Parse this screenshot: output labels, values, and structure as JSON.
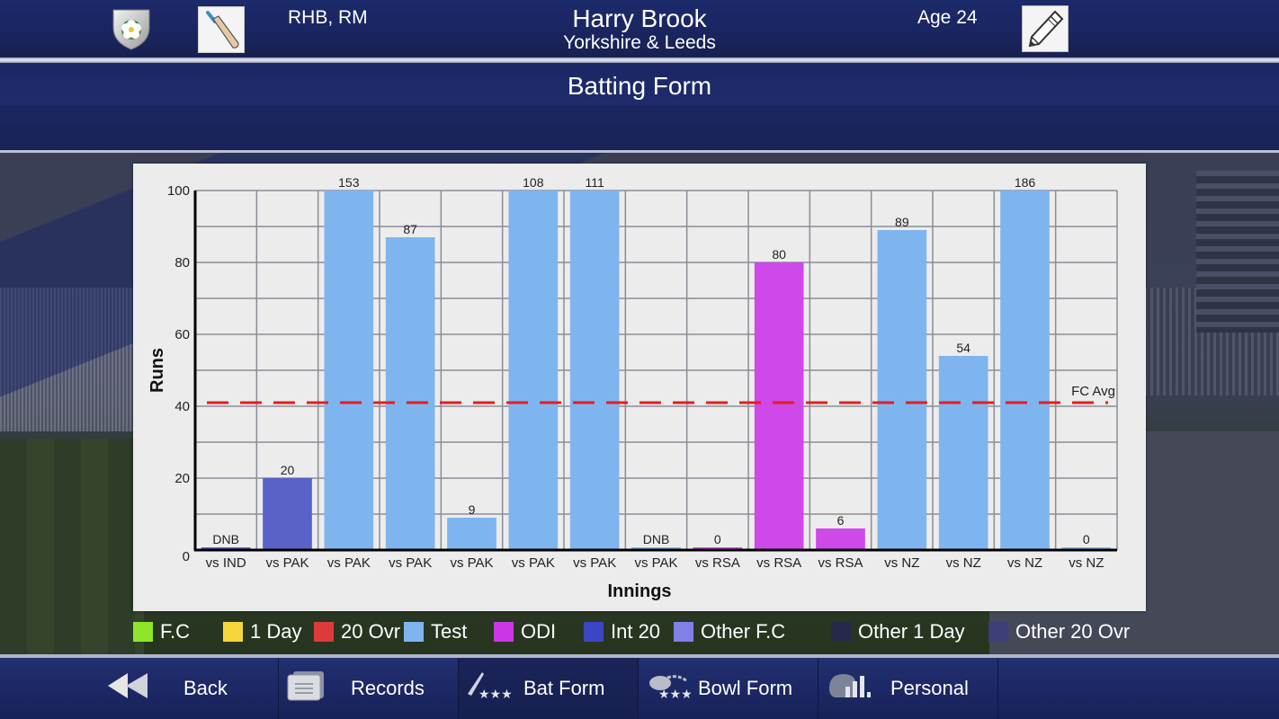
{
  "header": {
    "player_name": "Harry Brook",
    "club": "Yorkshire & Leeds",
    "roles": "RHB, RM",
    "age": "Age 24",
    "crest_icon": "yorkshire-rose-crest-icon",
    "bat_icon": "cricket-bat-icon",
    "edit_icon": "pencil-icon"
  },
  "page": {
    "title": "Batting Form"
  },
  "chart_data": {
    "type": "bar",
    "title": "Batting Form",
    "xlabel": "Innings",
    "ylabel": "Runs",
    "ylim": [
      0,
      100
    ],
    "yticks": [
      0,
      20,
      40,
      60,
      80,
      100
    ],
    "grid": true,
    "reference_line": {
      "label": "FC Avg",
      "value": 41,
      "color": "#e02020",
      "style": "dashed"
    },
    "categories": [
      "vs IND",
      "vs PAK",
      "vs PAK",
      "vs PAK",
      "vs PAK",
      "vs PAK",
      "vs PAK",
      "vs PAK",
      "vs RSA",
      "vs RSA",
      "vs RSA",
      "vs NZ",
      "vs NZ",
      "vs NZ",
      "vs NZ"
    ],
    "values": [
      0,
      20,
      153,
      87,
      9,
      108,
      111,
      0,
      0,
      80,
      6,
      89,
      54,
      186,
      0
    ],
    "labels": [
      "DNB",
      "20",
      "153",
      "87",
      "9",
      "108",
      "111",
      "DNB",
      "0",
      "80",
      "6",
      "89",
      "54",
      "186",
      "0"
    ],
    "formats": [
      "Int 20",
      "Int 20",
      "Test",
      "Test",
      "Test",
      "Test",
      "Test",
      "Test",
      "ODI",
      "ODI",
      "ODI",
      "Test",
      "Test",
      "Test",
      "Test"
    ]
  },
  "legend": [
    {
      "label": "F.C",
      "color": "#8ee62a"
    },
    {
      "label": "1 Day",
      "color": "#f4d63a"
    },
    {
      "label": "20 Ovr",
      "color": "#de3a3a"
    },
    {
      "label": "Test",
      "color": "#7fb5ef"
    },
    {
      "label": "ODI",
      "color": "#cc36e6"
    },
    {
      "label": "Int 20",
      "color": "#3b46c4"
    },
    {
      "label": "Other F.C",
      "color": "#8080e8"
    },
    {
      "label": "Other 1 Day",
      "color": "#262a48"
    },
    {
      "label": "Other 20 Ovr",
      "color": "#3c3f78"
    }
  ],
  "format_colors": {
    "Test": "#7fb5ef",
    "ODI": "#cf48ea",
    "Int 20": "#5a62c8"
  },
  "nav": [
    {
      "label": "Back",
      "icon": "double-chevron-left-icon"
    },
    {
      "label": "Records",
      "icon": "folder-icon"
    },
    {
      "label": "Bat Form",
      "icon": "bat-stars-icon",
      "active": true
    },
    {
      "label": "Bowl Form",
      "icon": "ball-stars-icon"
    },
    {
      "label": "Personal",
      "icon": "helmet-stats-icon"
    }
  ]
}
